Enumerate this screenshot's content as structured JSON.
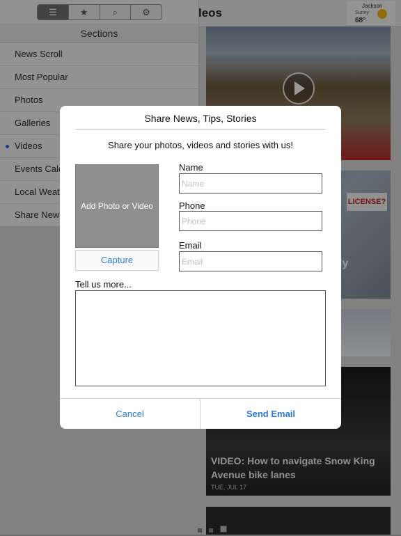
{
  "background": {
    "header_title_fragment": "leos",
    "weather": {
      "city": "Jackson",
      "condition": "Sunny",
      "temp": "68°"
    },
    "feature_caption": "VIDEO: How to navigate Snow King Avenue bike lanes",
    "feature_date": "TUE, JUL 17",
    "sign_text": "LICENSE?",
    "overlay_fragment": "ly"
  },
  "sidebar": {
    "segments": [
      "list-icon",
      "star-icon",
      "search-icon",
      "gear-icon"
    ],
    "active_segment": 0,
    "header": "Sections",
    "items": [
      {
        "label": "News Scroll"
      },
      {
        "label": "Most Popular"
      },
      {
        "label": "Photos"
      },
      {
        "label": "Galleries"
      },
      {
        "label": "Videos",
        "selected": true
      },
      {
        "label": "Events Cale"
      },
      {
        "label": "Local Weath"
      },
      {
        "label": "Share News"
      }
    ]
  },
  "dialog": {
    "title": "Share News, Tips, Stories",
    "subtitle": "Share your photos, videos and stories with us!",
    "photo_button": "Add Photo or Video",
    "capture_button": "Capture",
    "name_label": "Name",
    "name_placeholder": "Name",
    "phone_label": "Phone",
    "phone_placeholder": "Phone",
    "email_label": "Email",
    "email_placeholder": "Email",
    "message_label": "Tell us more...",
    "cancel_label": "Cancel",
    "send_label": "Send Email"
  },
  "colors": {
    "accent": "#2a7ad9",
    "selected_dot": "#1f6fd1"
  }
}
